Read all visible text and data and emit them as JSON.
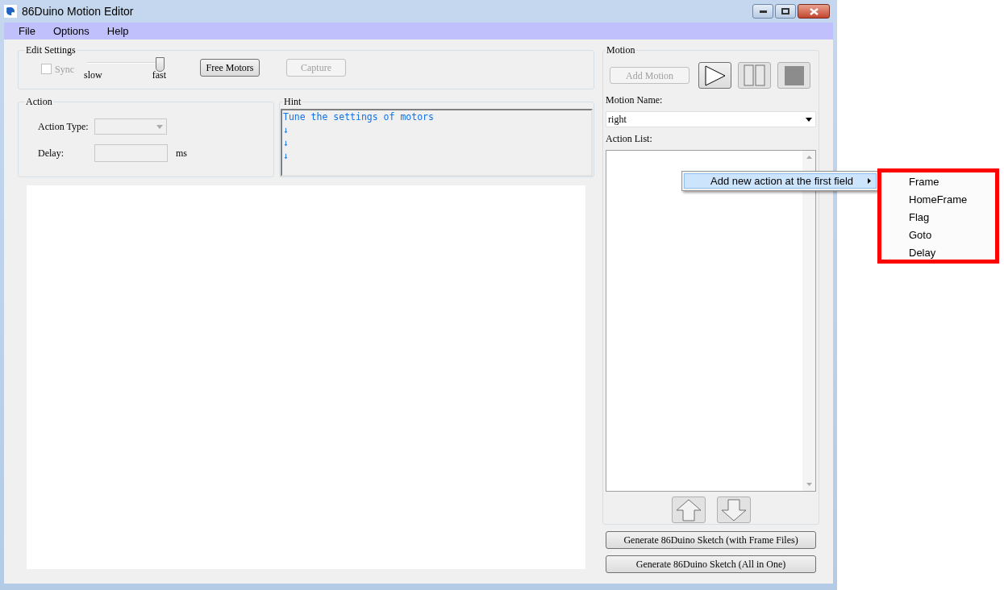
{
  "window": {
    "title": "86Duino Motion Editor"
  },
  "menu": [
    "File",
    "Options",
    "Help"
  ],
  "edit_settings": {
    "title": "Edit Settings",
    "sync": {
      "label": "Sync",
      "checked": false,
      "disabled": true
    },
    "speed": {
      "level": 1,
      "min_label": "slow",
      "max_label": "fast"
    },
    "buttons": [
      {
        "label": "Free Motors",
        "disabled": false
      },
      {
        "label": "Capture",
        "disabled": true
      }
    ]
  },
  "action": {
    "title": "Action",
    "type_label": "Action Type:",
    "delay_label": "Delay:",
    "delay_unit": "ms"
  },
  "hint": {
    "title": "Hint",
    "lines": [
      "Tune the settings of motors",
      "↓",
      "↓",
      "↓"
    ]
  },
  "motion": {
    "title": "Motion",
    "add_motion": {
      "label": "Add Motion",
      "disabled": true
    },
    "name_label": "Motion Name:",
    "name_value": "right",
    "list_label": "Action List:"
  },
  "generate_buttons": [
    "Generate 86Duino Sketch (with Frame Files)",
    "Generate 86Duino Sketch (All in One)"
  ],
  "context_menu": {
    "items": [
      {
        "label": "Add new action at the first field",
        "selected": true,
        "has_submenu": true
      }
    ]
  },
  "submenu": {
    "items": [
      "Frame",
      "HomeFrame",
      "Flag",
      "Goto",
      "Delay"
    ]
  }
}
